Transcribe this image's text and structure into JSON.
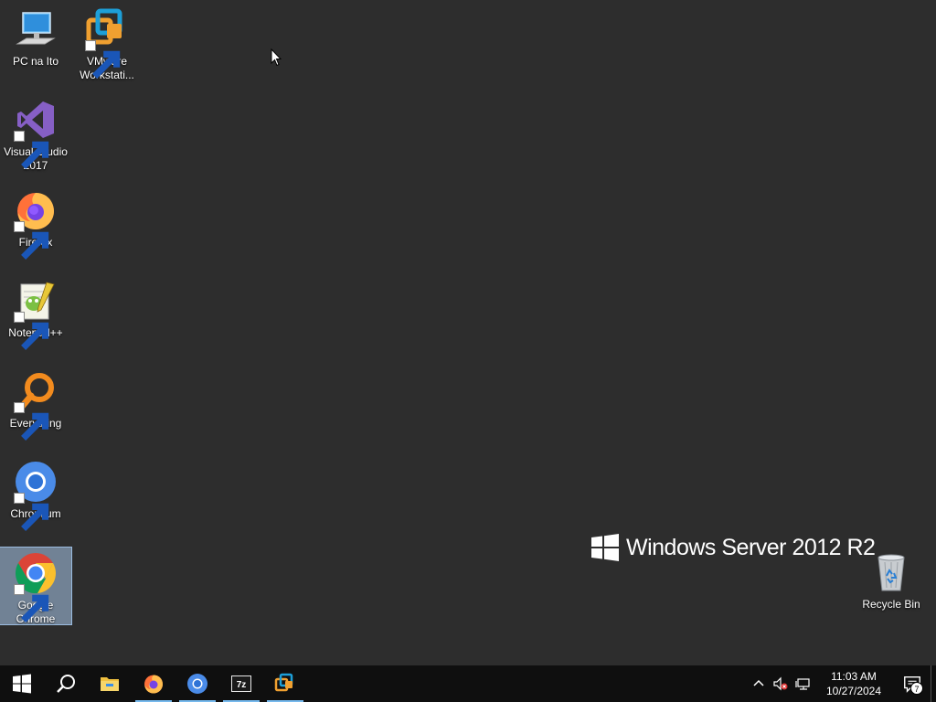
{
  "desktop": {
    "icons": [
      {
        "label": "PC na Ito",
        "icon": "computer-icon"
      },
      {
        "label": "VMware Workstati...",
        "icon": "vmware-icon"
      },
      {
        "label": "Visual Studio 2017",
        "icon": "visual-studio-icon"
      },
      {
        "label": "Firefox",
        "icon": "firefox-icon"
      },
      {
        "label": "Notepad++",
        "icon": "notepad-plus-plus-icon"
      },
      {
        "label": "Everything",
        "icon": "everything-search-icon"
      },
      {
        "label": "Chromium",
        "icon": "chromium-icon"
      },
      {
        "label": "Google Chrome",
        "icon": "google-chrome-icon",
        "selected": true
      },
      {
        "label": "Recycle Bin",
        "icon": "recycle-bin-icon"
      }
    ],
    "branding": "Windows Server 2012 R2"
  },
  "taskbar": {
    "buttons": [
      {
        "name": "start",
        "icon": "windows-start-icon"
      },
      {
        "name": "search",
        "icon": "search-icon"
      },
      {
        "name": "file-explorer",
        "icon": "folder-icon"
      },
      {
        "name": "firefox",
        "icon": "firefox-icon",
        "running": true
      },
      {
        "name": "chromium",
        "icon": "chromium-icon",
        "running": true
      },
      {
        "name": "7zip",
        "icon": "7zip-icon",
        "running": true
      },
      {
        "name": "vmware",
        "icon": "vmware-icon",
        "running": true
      }
    ],
    "tray": {
      "time": "11:03 AM",
      "date": "10/27/2024",
      "notification_count": "7"
    }
  },
  "colors": {
    "desktop_bg": "#2d2d2d",
    "taskbar_bg": "#0f0f0f",
    "running_indicator": "#76b9ed",
    "selection": "#aac8eb"
  }
}
